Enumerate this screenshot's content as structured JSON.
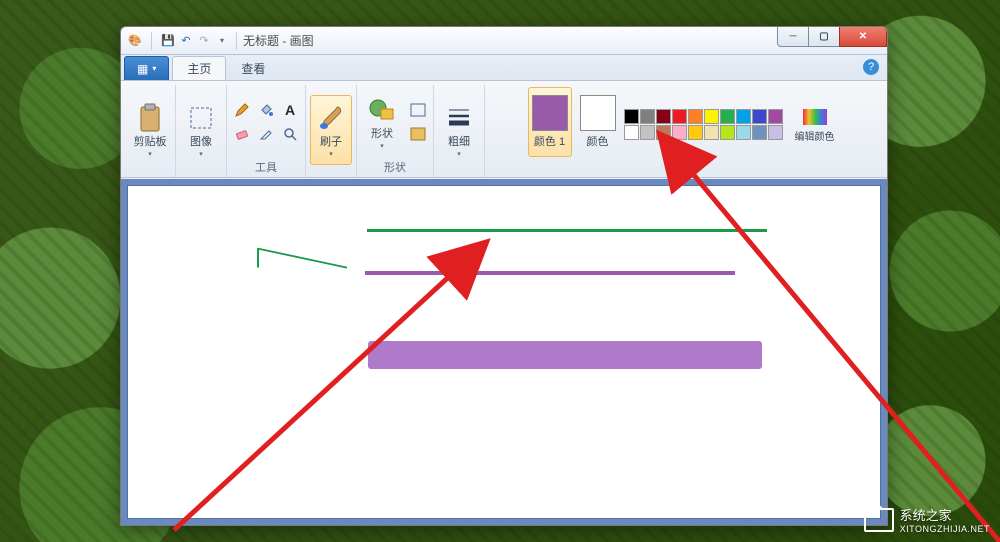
{
  "window": {
    "title": "无标题 - 画图"
  },
  "qat": {
    "save_icon": "💾",
    "undo_icon": "↶",
    "redo_icon": "↷"
  },
  "tabs": {
    "file": "▦",
    "home": "主页",
    "view": "查看"
  },
  "ribbon": {
    "clipboard": {
      "label": "剪贴板"
    },
    "image": {
      "label": "图像"
    },
    "tools": {
      "label": "工具"
    },
    "brushes": {
      "label": "刷子"
    },
    "shapes": {
      "label": "形状"
    },
    "size": {
      "label": "粗细"
    },
    "colors": {
      "label": "颜色",
      "color1_label": "颜色 1",
      "color2_label": "颜色",
      "edit_label": "编辑颜色",
      "color1_value": "#9a5aaa",
      "color2_value": "#ffffff",
      "swatches": [
        "#000000",
        "#7f7f7f",
        "#880015",
        "#ed1c24",
        "#ff7f27",
        "#fff200",
        "#22b14c",
        "#00a2e8",
        "#3f48cc",
        "#a349a4",
        "#ffffff",
        "#c3c3c3",
        "#b97a57",
        "#ffaec9",
        "#ffc90e",
        "#efe4b0",
        "#b5e61d",
        "#99d9ea",
        "#7092be",
        "#c8bfe7"
      ]
    }
  },
  "help": "?",
  "watermark": {
    "brand": "系统之家",
    "url": "XITONGZHIJIA.NET"
  },
  "chart_data": {
    "type": "canvas-drawing",
    "strokes": [
      {
        "color": "#1a9a4a",
        "thickness": 3,
        "y_approx": 44,
        "x_range": [
          240,
          640
        ],
        "shape": "straight-line"
      },
      {
        "color": "#1a9a4a",
        "thickness": 2,
        "shape": "hook",
        "from": [
          130,
          92
        ],
        "to": [
          222,
          82
        ]
      },
      {
        "color": "#9a5aaa",
        "thickness": 4,
        "y_approx": 86,
        "x_range": [
          238,
          608
        ],
        "shape": "straight-line"
      },
      {
        "color": "#b07acb",
        "thickness": 28,
        "y_approx": 170,
        "x_range": [
          241,
          635
        ],
        "shape": "thick-brush-line"
      }
    ]
  }
}
